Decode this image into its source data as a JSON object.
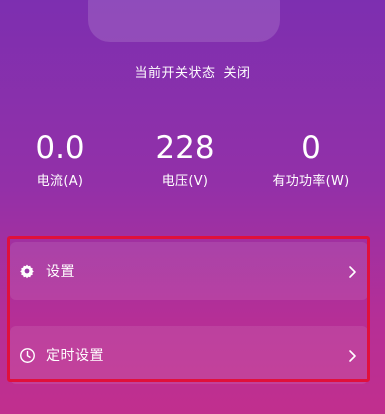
{
  "status": {
    "label": "当前开关状态",
    "value": "关闭"
  },
  "metrics": [
    {
      "value": "0.0",
      "label": "电流(A)"
    },
    {
      "value": "228",
      "label": "电压(V)"
    },
    {
      "value": "0",
      "label": "有功功率(W)"
    }
  ],
  "menu": {
    "items": [
      {
        "label": "设置",
        "icon": "settings-gear-icon"
      },
      {
        "label": "定时设置",
        "icon": "clock-icon"
      }
    ]
  },
  "colors": {
    "background_top": "#7d2fb0",
    "background_bottom": "#c12f8e",
    "highlight": "#e0103c"
  }
}
